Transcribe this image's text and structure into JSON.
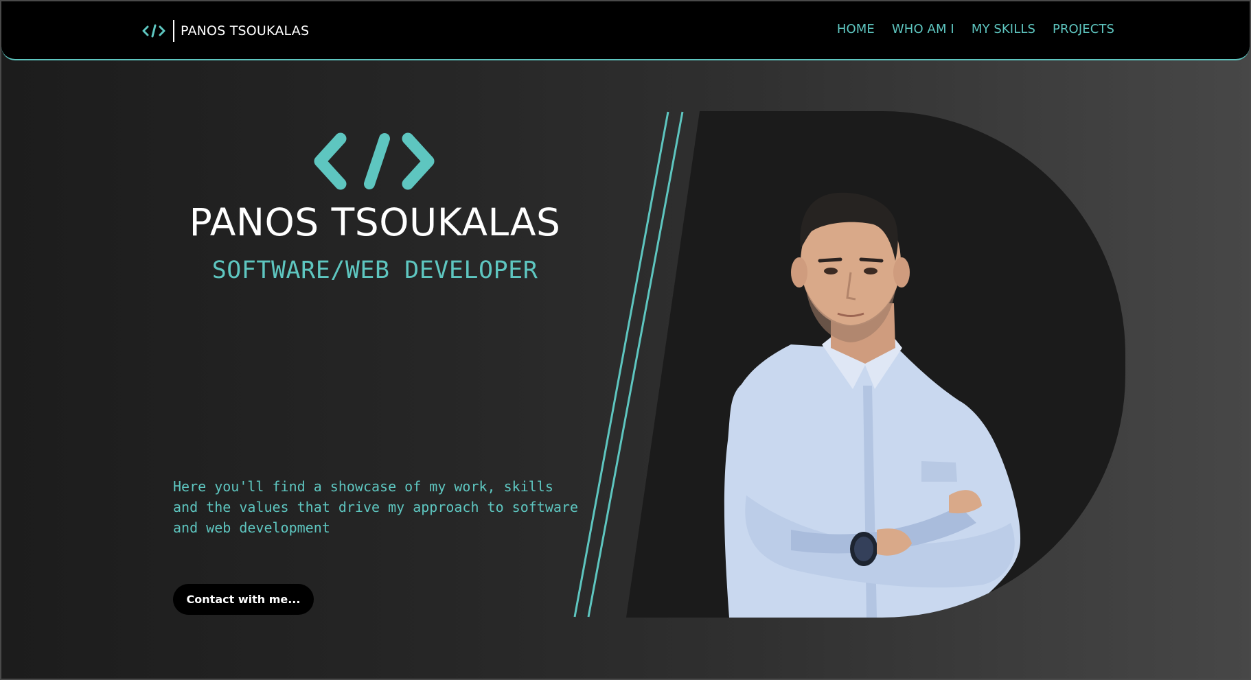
{
  "header": {
    "brand_name": "PANOS TSOUKALAS",
    "brand_icon": "code-icon",
    "nav": [
      {
        "label": "HOME"
      },
      {
        "label": "WHO AM I"
      },
      {
        "label": "MY SKILLS"
      },
      {
        "label": "PROJECTS"
      }
    ]
  },
  "hero": {
    "logo_icon": "code-icon",
    "name": "PANOS TSOUKALAS",
    "role": "SOFTWARE/WEB DEVELOPER",
    "description": "Here you'll find a showcase of my work, skills and the values that drive my approach to software and web development",
    "contact_label": "Contact with me...",
    "portrait": "person-portrait"
  },
  "colors": {
    "accent": "#5ec6c0",
    "header_bg": "#000000",
    "panel_bg": "#1c1c1c",
    "shirt": "#c9d8ef"
  }
}
